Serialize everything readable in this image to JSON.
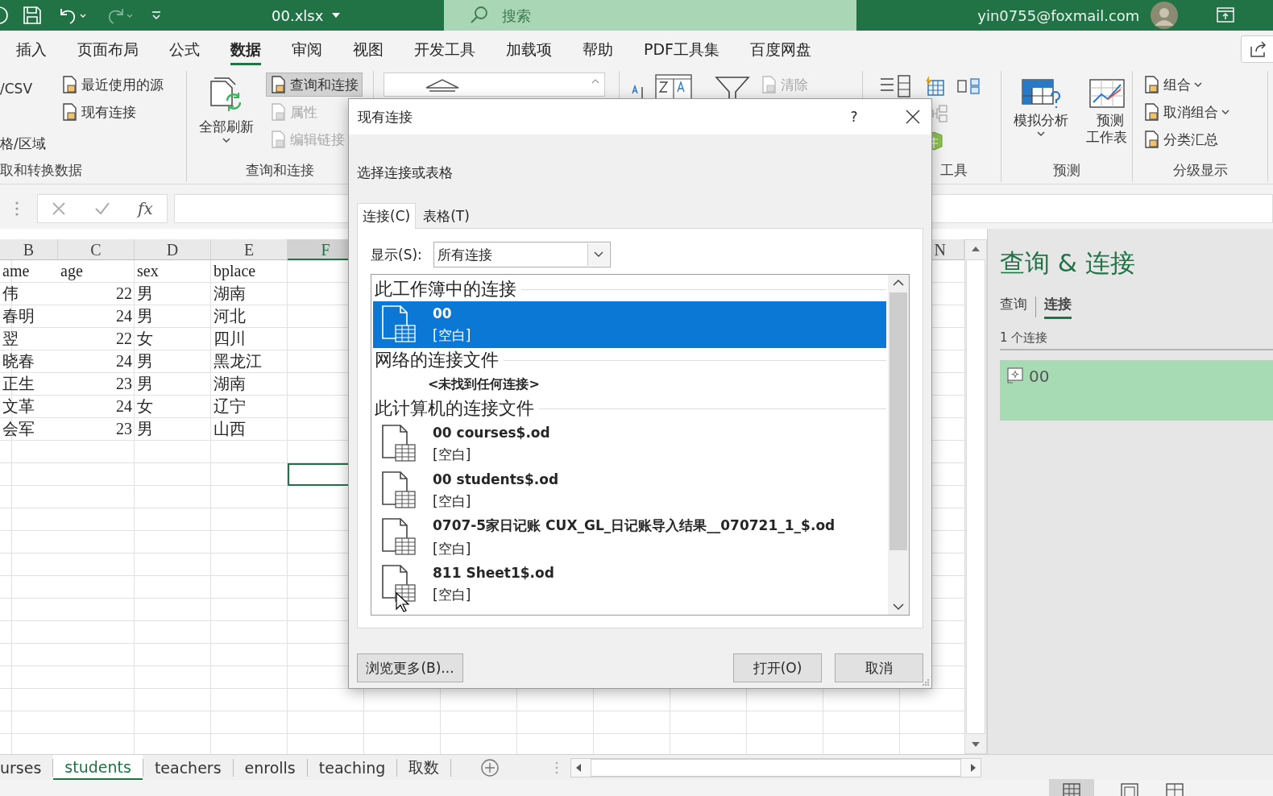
{
  "title_bar": {
    "file_name": "00.xlsx",
    "search": {
      "placeholder": "搜索"
    },
    "account": "yin0755@foxmail.com"
  },
  "ribbon_tabs": [
    {
      "label": "插入",
      "selected": false
    },
    {
      "label": "页面布局",
      "selected": false
    },
    {
      "label": "公式",
      "selected": false
    },
    {
      "label": "数据",
      "selected": true
    },
    {
      "label": "审阅",
      "selected": false
    },
    {
      "label": "视图",
      "selected": false
    },
    {
      "label": "开发工具",
      "selected": false
    },
    {
      "label": "加载项",
      "selected": false
    },
    {
      "label": "帮助",
      "selected": false
    },
    {
      "label": "PDF工具集",
      "selected": false
    },
    {
      "label": "百度网盘",
      "selected": false
    }
  ],
  "ribbon_groups": [
    {
      "kind": "commands",
      "label": "取和转换数据",
      "columns": [
        [
          {
            "label": "/CSV",
            "kind": "text",
            "disabled": false,
            "pressed": false,
            "dropdown": false
          },
          {
            "label": "格/区域",
            "kind": "text",
            "disabled": false,
            "pressed": false,
            "dropdown": false
          }
        ],
        [
          {
            "label": "最近使用的源",
            "kind": "small",
            "disabled": false,
            "pressed": false,
            "dropdown": false
          },
          {
            "label": "现有连接",
            "kind": "small",
            "disabled": false,
            "pressed": false,
            "dropdown": false
          }
        ]
      ]
    },
    {
      "kind": "commands",
      "label": "查询和连接",
      "columns": [
        [
          {
            "label": "全部刷新",
            "kind": "large",
            "disabled": false,
            "pressed": false,
            "dropdown": true
          }
        ],
        [
          {
            "label": "查询和连接",
            "kind": "small",
            "disabled": false,
            "pressed": true,
            "dropdown": false
          },
          {
            "label": "属性",
            "kind": "small",
            "disabled": true,
            "pressed": false,
            "dropdown": false
          },
          {
            "label": "编辑链接",
            "kind": "small",
            "disabled": true,
            "pressed": false,
            "dropdown": false
          }
        ]
      ]
    },
    {
      "kind": "gallery"
    },
    {
      "kind": "sort_filter",
      "columns": [
        [
          {
            "label": "清除",
            "kind": "small",
            "disabled": true,
            "pressed": false,
            "dropdown": false
          }
        ]
      ]
    },
    {
      "kind": "data_tools",
      "label": "工具"
    },
    {
      "kind": "commands",
      "label": "预测",
      "columns": [
        [
          {
            "label": "模拟分析",
            "kind": "large",
            "disabled": false,
            "pressed": false,
            "dropdown": true
          }
        ],
        [
          {
            "label": "预测工作表",
            "kind": "large_two_line",
            "disabled": false,
            "pressed": false,
            "dropdown": false
          }
        ]
      ]
    },
    {
      "kind": "commands",
      "label": "分级显示",
      "columns": [
        [
          {
            "label": "组合",
            "kind": "small",
            "disabled": false,
            "pressed": false,
            "dropdown": true
          },
          {
            "label": "取消组合",
            "kind": "small",
            "disabled": false,
            "pressed": false,
            "dropdown": true
          },
          {
            "label": "分类汇总",
            "kind": "small",
            "disabled": false,
            "pressed": false,
            "dropdown": false
          }
        ]
      ]
    }
  ],
  "formula_bar": {
    "function_label": "fx"
  },
  "column_headers": [
    {
      "label": "B",
      "selected": false
    },
    {
      "label": "C",
      "selected": false
    },
    {
      "label": "D",
      "selected": false
    },
    {
      "label": "E",
      "selected": false
    },
    {
      "label": "F",
      "selected": true
    },
    {
      "label": "N",
      "selected": false
    }
  ],
  "rows": [
    [
      "ame",
      "age",
      "sex",
      "bplace"
    ],
    [
      "伟",
      "22",
      "男",
      "湖南"
    ],
    [
      "春明",
      "24",
      "男",
      "河北"
    ],
    [
      "翌",
      "22",
      "女",
      "四川"
    ],
    [
      "晓春",
      "24",
      "男",
      "黑龙江"
    ],
    [
      "正生",
      "23",
      "男",
      "湖南"
    ],
    [
      "文革",
      "24",
      "女",
      "辽宁"
    ],
    [
      "会军",
      "23",
      "男",
      "山西"
    ]
  ],
  "sheet_tabs": [
    {
      "label": "urses",
      "selected": false
    },
    {
      "label": "students",
      "selected": true
    },
    {
      "label": "teachers",
      "selected": false
    },
    {
      "label": "enrolls",
      "selected": false
    },
    {
      "label": "teaching",
      "selected": false
    },
    {
      "label": "取数",
      "selected": false
    }
  ],
  "queries_pane": {
    "title": "查询 & 连接",
    "tabs": [
      {
        "label": "查询",
        "selected": false
      },
      {
        "label": "连接",
        "selected": true
      }
    ],
    "count": "1 个连接",
    "items": [
      {
        "name": "00",
        "selected": true
      }
    ]
  },
  "dialog": {
    "title": "现有连接",
    "help": "?",
    "prompt": "选择连接或表格",
    "tabs": [
      {
        "label": "连接(C)",
        "selected": true
      },
      {
        "label": "表格(T)",
        "selected": false
      }
    ],
    "show_label": "显示(S):",
    "show_value": "所有连接",
    "sections": [
      {
        "heading": "此工作簿中的连接",
        "items": [
          {
            "name": "00",
            "description": "[空白]",
            "selected": true
          }
        ]
      },
      {
        "heading": "网络的连接文件",
        "empty_text": "<未找到任何连接>"
      },
      {
        "heading": "此计算机的连接文件",
        "items": [
          {
            "name": "00 courses$.od",
            "description": "[空白]",
            "selected": false
          },
          {
            "name": "00 students$.od",
            "description": "[空白]",
            "selected": false
          },
          {
            "name": "0707-5家日记账 CUX_GL_日记账导入结果__070721_1_$.od",
            "description": "[空白]",
            "selected": false
          },
          {
            "name": "811 Sheet1$.od",
            "description": "[空白]",
            "selected": false
          }
        ]
      }
    ],
    "buttons": [
      {
        "label": "浏览更多(B)..."
      },
      {
        "label": "打开(O)"
      },
      {
        "label": "取消"
      }
    ]
  }
}
